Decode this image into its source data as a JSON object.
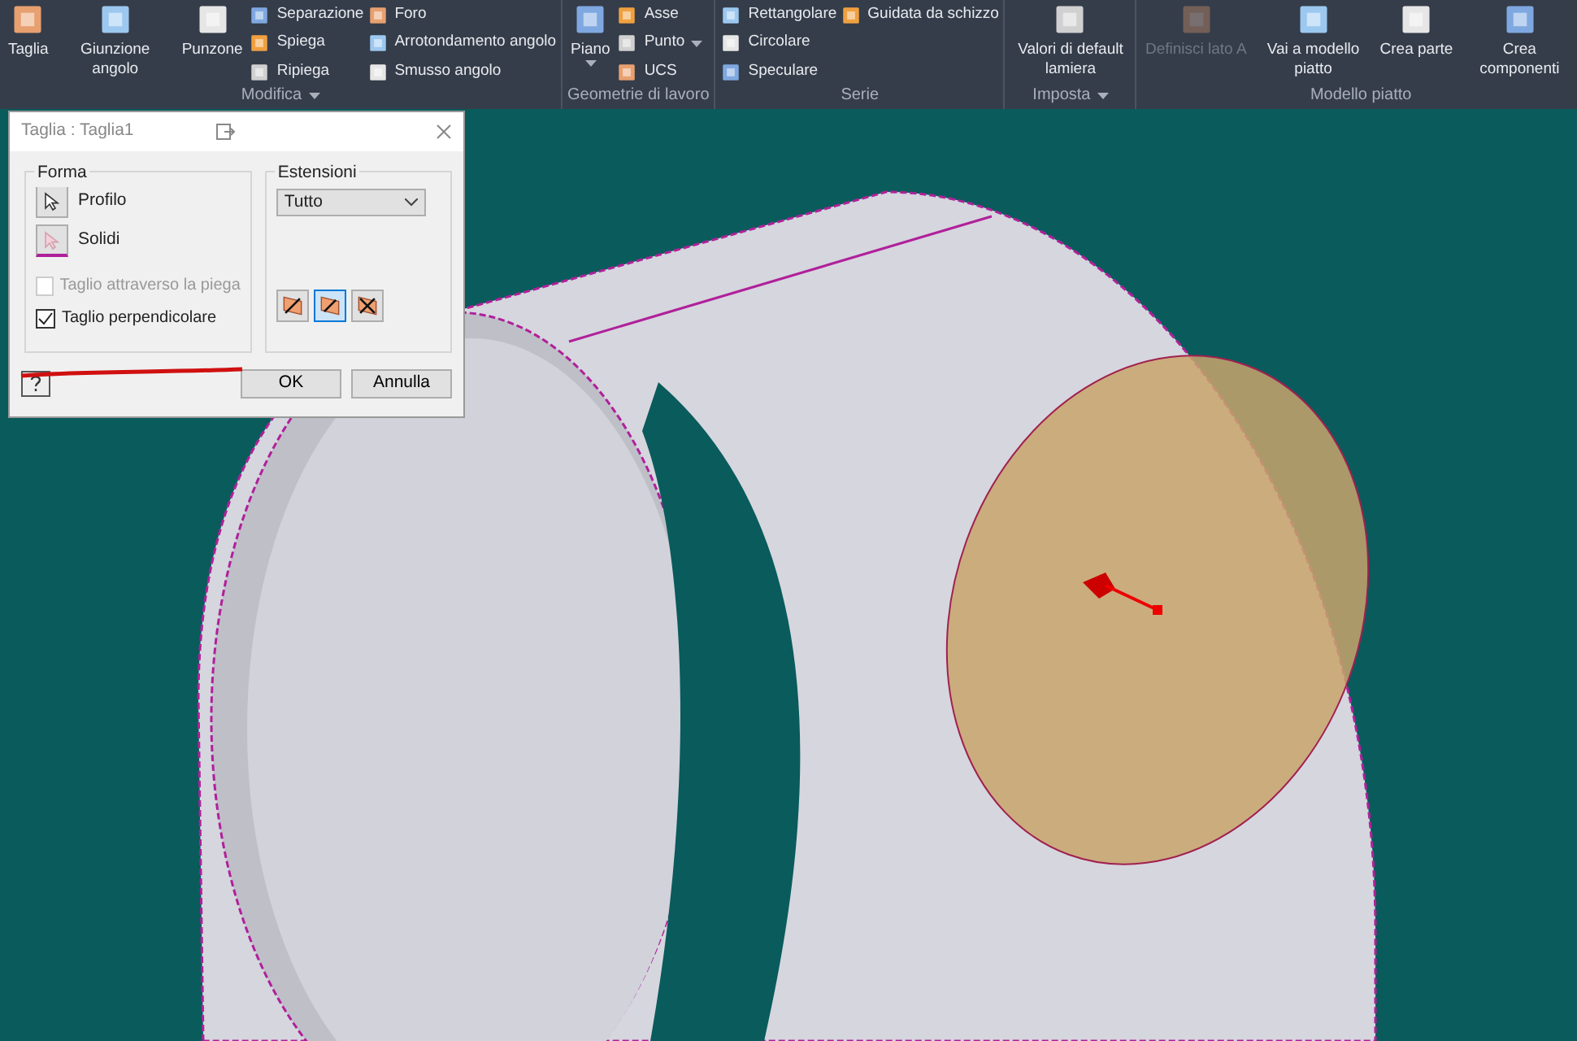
{
  "ribbon": {
    "groups": [
      {
        "label": "Modifica",
        "has_menu": true,
        "columns": [
          {
            "kind": "large",
            "label": "Taglia",
            "disabled": false,
            "dropdown": false
          },
          {
            "kind": "large",
            "label": "Giunzione angolo",
            "disabled": false,
            "dropdown": false
          },
          {
            "kind": "large",
            "label": "Punzone",
            "disabled": false,
            "dropdown": false
          },
          {
            "kind": "stack",
            "items": [
              {
                "label": "Separazione",
                "dropdown": false
              },
              {
                "label": "Spiega",
                "dropdown": false
              },
              {
                "label": "Ripiega",
                "dropdown": false
              }
            ]
          },
          {
            "kind": "stack",
            "items": [
              {
                "label": "Foro",
                "dropdown": false
              },
              {
                "label": "Arrotondamento angolo",
                "dropdown": false
              },
              {
                "label": "Smusso angolo",
                "dropdown": false
              }
            ]
          }
        ]
      },
      {
        "label": "Geometrie di lavoro",
        "has_menu": false,
        "columns": [
          {
            "kind": "large",
            "label": "Piano",
            "disabled": false,
            "dropdown": true
          },
          {
            "kind": "stack",
            "items": [
              {
                "label": "Asse",
                "dropdown": false
              },
              {
                "label": "Punto",
                "dropdown": true
              },
              {
                "label": "UCS",
                "dropdown": false
              }
            ]
          }
        ]
      },
      {
        "label": "Serie",
        "has_menu": false,
        "columns": [
          {
            "kind": "stack",
            "items": [
              {
                "label": "Rettangolare",
                "dropdown": false
              },
              {
                "label": "Circolare",
                "dropdown": false
              },
              {
                "label": "Speculare",
                "dropdown": false
              }
            ]
          },
          {
            "kind": "stack",
            "items": [
              {
                "label": "Guidata da schizzo",
                "dropdown": false
              }
            ]
          }
        ]
      },
      {
        "label": "Imposta",
        "has_menu": true,
        "columns": [
          {
            "kind": "large",
            "label": "Valori di default lamiera",
            "disabled": false,
            "dropdown": false
          }
        ]
      },
      {
        "label": "Modello piatto",
        "has_menu": false,
        "columns": [
          {
            "kind": "large",
            "label": "Definisci lato A",
            "disabled": true,
            "dropdown": false
          },
          {
            "kind": "large",
            "label": "Vai a modello piatto",
            "disabled": false,
            "dropdown": false
          },
          {
            "kind": "large",
            "label": "Crea parte",
            "disabled": false,
            "dropdown": false
          },
          {
            "kind": "large",
            "label": "Crea componenti",
            "disabled": false,
            "dropdown": false
          }
        ]
      }
    ]
  },
  "dialog": {
    "title": "Taglia : Taglia1",
    "forma": {
      "label": "Forma",
      "selectors": [
        {
          "label": "Profilo",
          "needs_input": false
        },
        {
          "label": "Solidi",
          "needs_input": true
        }
      ]
    },
    "options": [
      {
        "label": "Taglio attraverso la piega",
        "checked": false,
        "disabled": true
      },
      {
        "label": "Taglio perpendicolare",
        "checked": true,
        "disabled": false
      }
    ],
    "estensioni": {
      "label": "Estensioni",
      "value": "Tutto",
      "directions": [
        {
          "selected": false
        },
        {
          "selected": true
        },
        {
          "selected": false
        }
      ]
    },
    "buttons": [
      "OK",
      "Annulla"
    ]
  }
}
